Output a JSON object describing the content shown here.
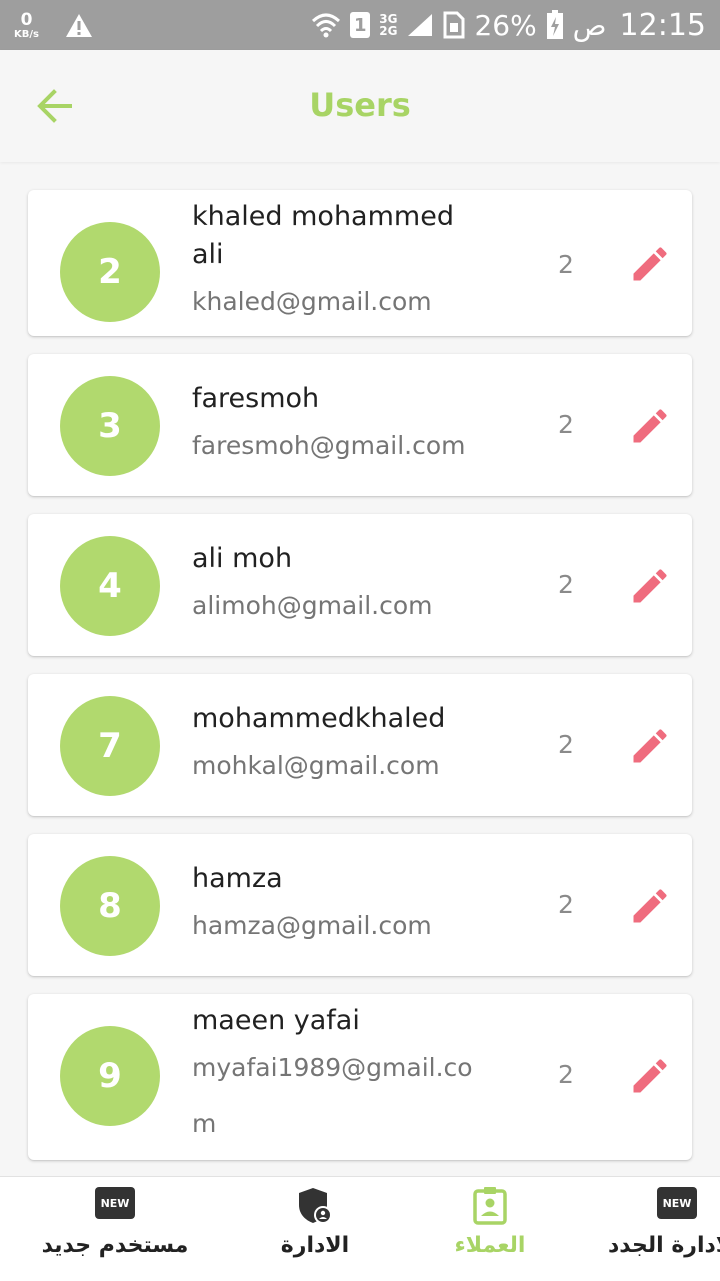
{
  "status_bar": {
    "net_speed": "0",
    "net_speed_unit": "KB/s",
    "sim_slot": "1",
    "network_top": "3G",
    "network_bottom": "2G",
    "battery": "26%",
    "ampm": "ص",
    "time": "12:15"
  },
  "header": {
    "title": "Users"
  },
  "users": [
    {
      "id": "2",
      "name": "khaled mohammed ali",
      "email": "khaled@gmail.com",
      "count": "2"
    },
    {
      "id": "3",
      "name": "faresmoh",
      "email": "faresmoh@gmail.com",
      "count": "2"
    },
    {
      "id": "4",
      "name": "ali moh",
      "email": "alimoh@gmail.com",
      "count": "2"
    },
    {
      "id": "7",
      "name": "mohammedkhaled",
      "email": "mohkal@gmail.com",
      "count": "2"
    },
    {
      "id": "8",
      "name": "hamza",
      "email": "hamza@gmail.com",
      "count": "2"
    },
    {
      "id": "9",
      "name": "maeen yafai",
      "email": "myafai1989@gmail.com",
      "count": "2"
    }
  ],
  "bottom_nav": {
    "badge_text": "NEW",
    "items": [
      {
        "label": "مستخدم جديد",
        "icon": "new-badge-icon"
      },
      {
        "label": "الادارة",
        "icon": "admin-shield-icon"
      },
      {
        "label": "العملاء",
        "icon": "contact-card-icon"
      },
      {
        "label": "الادارة الجدد",
        "icon": "new-badge-icon"
      }
    ]
  },
  "colors": {
    "accent": "#a8d465",
    "avatar": "#b1d96e",
    "edit_icon": "#ef6c7e",
    "status_bar": "#9e9e9e"
  }
}
